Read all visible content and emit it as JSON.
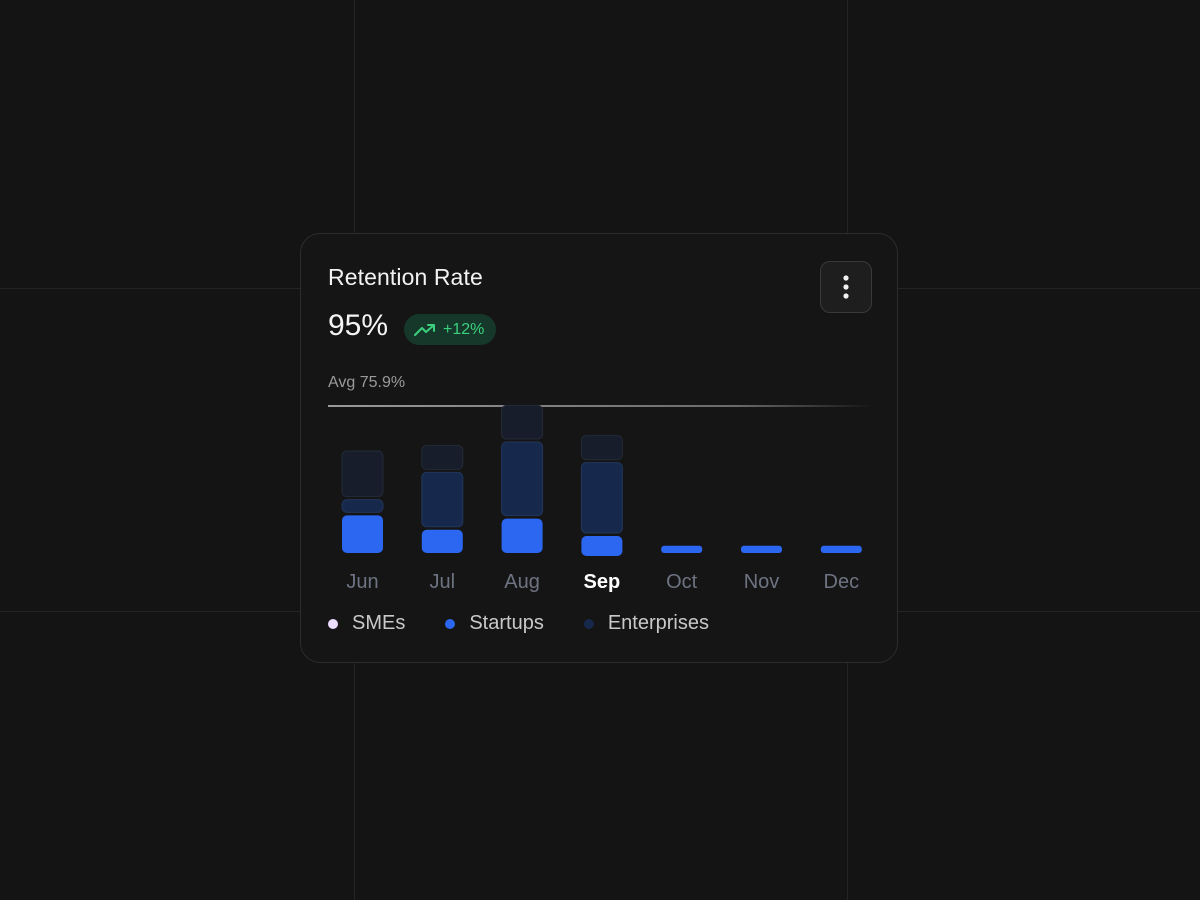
{
  "card": {
    "title": "Retention Rate",
    "metric_value": "95%",
    "change_label": "+12%",
    "menu_icon": "kebab-menu-icon",
    "trend_icon": "trending-up-icon"
  },
  "colors": {
    "background": "#141414",
    "card": "#151515",
    "smes": "#ecdcff",
    "startups": "#2b67f0",
    "enterprises": "#16294d",
    "top_segment": "#171d2b",
    "positive": "#3ccf7e",
    "muted_label": "#6e7382",
    "active_label": "#ffffff"
  },
  "chart_data": {
    "type": "bar",
    "stacked": true,
    "average_label": "Avg 75.9%",
    "categories": [
      "Jun",
      "Jul",
      "Aug",
      "Sep",
      "Oct",
      "Nov",
      "Dec"
    ],
    "highlighted_category": "Sep",
    "series": [
      {
        "name": "Startups",
        "values": [
          47,
          29,
          43,
          25,
          9,
          9,
          9
        ]
      },
      {
        "name": "Enterprises",
        "values": [
          16,
          68,
          92,
          88,
          0,
          0,
          0
        ]
      },
      {
        "name": "",
        "values": [
          57,
          30,
          42,
          30,
          0,
          0,
          0
        ]
      }
    ],
    "legend": [
      {
        "name": "SMEs",
        "color_key": "smes"
      },
      {
        "name": "Startups",
        "color_key": "startups"
      },
      {
        "name": "Enterprises",
        "color_key": "enterprises"
      }
    ]
  }
}
